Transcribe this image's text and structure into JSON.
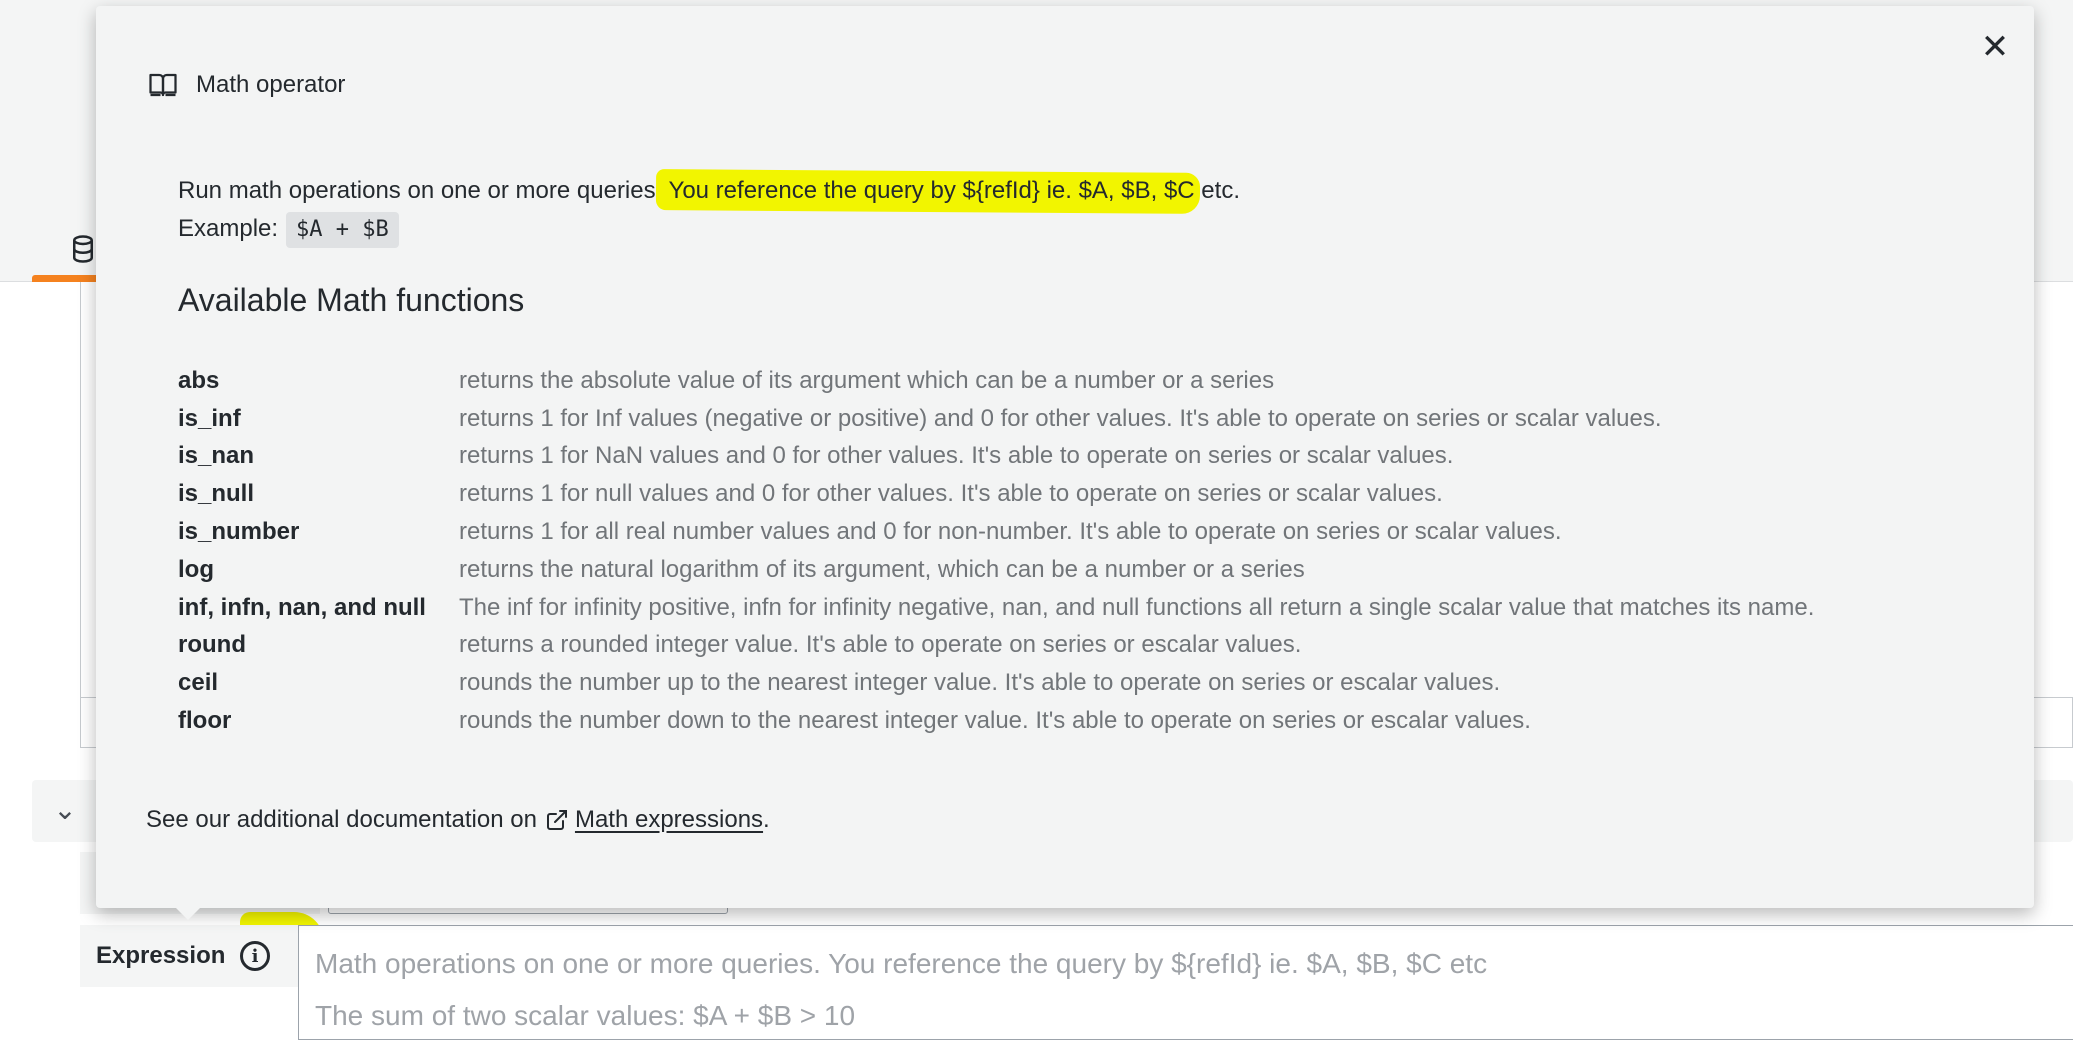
{
  "popover": {
    "title": "Math operator",
    "intro_text": "Run math operations on one or more queries.",
    "intro_highlight": " You reference the query by ${refId} ie. $A, $B, $C",
    "intro_tail": " etc.",
    "example_label": "Example:",
    "example_code": "$A + $B",
    "section_title": "Available Math functions",
    "functions": [
      {
        "name": "abs",
        "desc": "returns the absolute value of its argument which can be a number or a series"
      },
      {
        "name": "is_inf",
        "desc": "returns 1 for Inf values (negative or positive) and 0 for other values. It's able to operate on series or scalar values."
      },
      {
        "name": "is_nan",
        "desc": "returns 1 for NaN values and 0 for other values. It's able to operate on series or scalar values."
      },
      {
        "name": "is_null",
        "desc": "returns 1 for null values and 0 for other values. It's able to operate on series or scalar values."
      },
      {
        "name": "is_number",
        "desc": "returns 1 for all real number values and 0 for non-number. It's able to operate on series or scalar values."
      },
      {
        "name": "log",
        "desc": "returns the natural logarithm of its argument, which can be a number or a series"
      },
      {
        "name": "inf, infn, nan, and null",
        "desc": "The inf for infinity positive, infn for infinity negative, nan, and null functions all return a single scalar value that matches its name."
      },
      {
        "name": "round",
        "desc": "returns a rounded integer value. It's able to operate on series or escalar values."
      },
      {
        "name": "ceil",
        "desc": "rounds the number up to the nearest integer value. It's able to operate on series or escalar values."
      },
      {
        "name": "floor",
        "desc": "rounds the number down to the nearest integer value. It's able to operate on series or escalar values."
      }
    ],
    "footer_text": "See our additional documentation on",
    "footer_link": " Math expressions",
    "footer_period": ".",
    "close_icon": "close-icon",
    "book_icon": "book-open-icon"
  },
  "expression": {
    "label": "Expression",
    "placeholder_line1": "Math operations on one or more queries. You reference the query by ${refId} ie. $A, $B, $C etc",
    "placeholder_line2": "The sum of two scalar values: $A + $B > 10"
  },
  "colors": {
    "highlight": "#f2f500",
    "tab_accent": "#f5821f",
    "popover_bg": "#f3f4f4"
  }
}
